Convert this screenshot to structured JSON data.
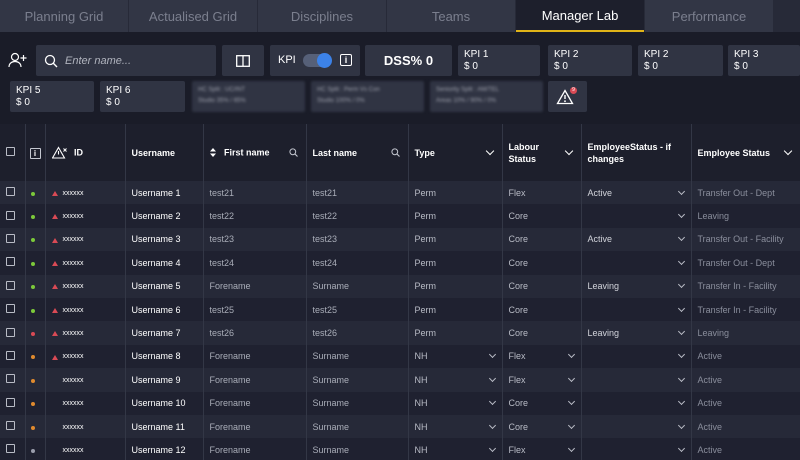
{
  "tabs": [
    {
      "label": "Planning Grid"
    },
    {
      "label": "Actualised Grid"
    },
    {
      "label": "Disciplines"
    },
    {
      "label": "Teams"
    },
    {
      "label": "Manager Lab"
    },
    {
      "label": "Performance"
    }
  ],
  "active_tab": "Manager Lab",
  "search": {
    "placeholder": "Enter name..."
  },
  "kpi_toggle": {
    "label": "KPI",
    "on": true
  },
  "dss": {
    "label": "DSS% 0"
  },
  "kpis": [
    {
      "name": "KPI 1",
      "value": "$ 0"
    },
    {
      "name": "KPI 2",
      "value": "$ 0"
    },
    {
      "name": "KPI 2",
      "value": "$ 0"
    },
    {
      "name": "KPI 3",
      "value": "$ 0"
    },
    {
      "name": "KPI 5",
      "value": "$ 0"
    },
    {
      "name": "KPI 6",
      "value": "$ 0"
    }
  ],
  "splits": [
    {
      "line1": "HC Split : UC/INT",
      "line2": "Studio 35% / 65%"
    },
    {
      "line1": "HC Split : Perm Vs Con",
      "line2": "Studio 100% / 0%"
    },
    {
      "line1": "Seniority Split : AM/TEL",
      "line2": "Areas 10% / 90% / 0%"
    }
  ],
  "alert_count": "9",
  "columns": {
    "id": "ID",
    "username": "Username",
    "first_name": "First name",
    "last_name": "Last name",
    "type": "Type",
    "labour_status": "Labour Status",
    "emp_status_changes": "EmployeeStatus - if changes",
    "employee_status": "Employee Status"
  },
  "rows": [
    {
      "id": "xxxxxx",
      "username": "Username 1",
      "first": "test21",
      "last": "test21",
      "type": "Perm",
      "labour": "Flex",
      "esc": "Active",
      "es": "Transfer Out - Dept",
      "dot": "#7cc93a",
      "warn": true,
      "dd": false
    },
    {
      "id": "xxxxxx",
      "username": "Username 2",
      "first": "test22",
      "last": "test22",
      "type": "Perm",
      "labour": "Core",
      "esc": "",
      "es": "Leaving",
      "dot": "#7cc93a",
      "warn": true,
      "dd": false
    },
    {
      "id": "xxxxxx",
      "username": "Username 3",
      "first": "test23",
      "last": "test23",
      "type": "Perm",
      "labour": "Core",
      "esc": "Active",
      "es": "Transfer Out - Facility",
      "dot": "#7cc93a",
      "warn": true,
      "dd": false
    },
    {
      "id": "xxxxxx",
      "username": "Username 4",
      "first": "test24",
      "last": "test24",
      "type": "Perm",
      "labour": "Core",
      "esc": "",
      "es": "Transfer Out - Dept",
      "dot": "#7cc93a",
      "warn": true,
      "dd": false
    },
    {
      "id": "xxxxxx",
      "username": "Username 5",
      "first": "Forename",
      "last": "Surname",
      "type": "Perm",
      "labour": "Core",
      "esc": "Leaving",
      "es": "Transfer In - Facility",
      "dot": "#7cc93a",
      "warn": true,
      "dd": false
    },
    {
      "id": "xxxxxx",
      "username": "Username 6",
      "first": "test25",
      "last": "test25",
      "type": "Perm",
      "labour": "Core",
      "esc": "",
      "es": "Transfer In - Facility",
      "dot": "#7cc93a",
      "warn": true,
      "dd": false
    },
    {
      "id": "xxxxxx",
      "username": "Username 7",
      "first": "test26",
      "last": "test26",
      "type": "Perm",
      "labour": "Core",
      "esc": "Leaving",
      "es": "Leaving",
      "dot": "#d94a55",
      "warn": true,
      "dd": false
    },
    {
      "id": "xxxxxx",
      "username": "Username 8",
      "first": "Forename",
      "last": "Surname",
      "type": "NH",
      "labour": "Flex",
      "esc": "",
      "es": "Active",
      "dot": "#e08a2e",
      "warn": true,
      "dd": true
    },
    {
      "id": "xxxxxx",
      "username": "Username 9",
      "first": "Forename",
      "last": "Surname",
      "type": "NH",
      "labour": "Flex",
      "esc": "",
      "es": "Active",
      "dot": "#e08a2e",
      "warn": false,
      "dd": true
    },
    {
      "id": "xxxxxx",
      "username": "Username 10",
      "first": "Forename",
      "last": "Surname",
      "type": "NH",
      "labour": "Core",
      "esc": "",
      "es": "Active",
      "dot": "#e08a2e",
      "warn": false,
      "dd": true
    },
    {
      "id": "xxxxxx",
      "username": "Username 11",
      "first": "Forename",
      "last": "Surname",
      "type": "NH",
      "labour": "Core",
      "esc": "",
      "es": "Active",
      "dot": "#e08a2e",
      "warn": false,
      "dd": true
    },
    {
      "id": "xxxxxx",
      "username": "Username 12",
      "first": "Forename",
      "last": "Surname",
      "type": "NH",
      "labour": "Flex",
      "esc": "",
      "es": "Active",
      "dot": "#9a9dab",
      "warn": false,
      "dd": true
    }
  ],
  "colors": {
    "accent": "#e0b418",
    "toggle": "#3c82e8",
    "warn": "#d94a55",
    "ok": "#7cc93a",
    "pending": "#e08a2e"
  }
}
